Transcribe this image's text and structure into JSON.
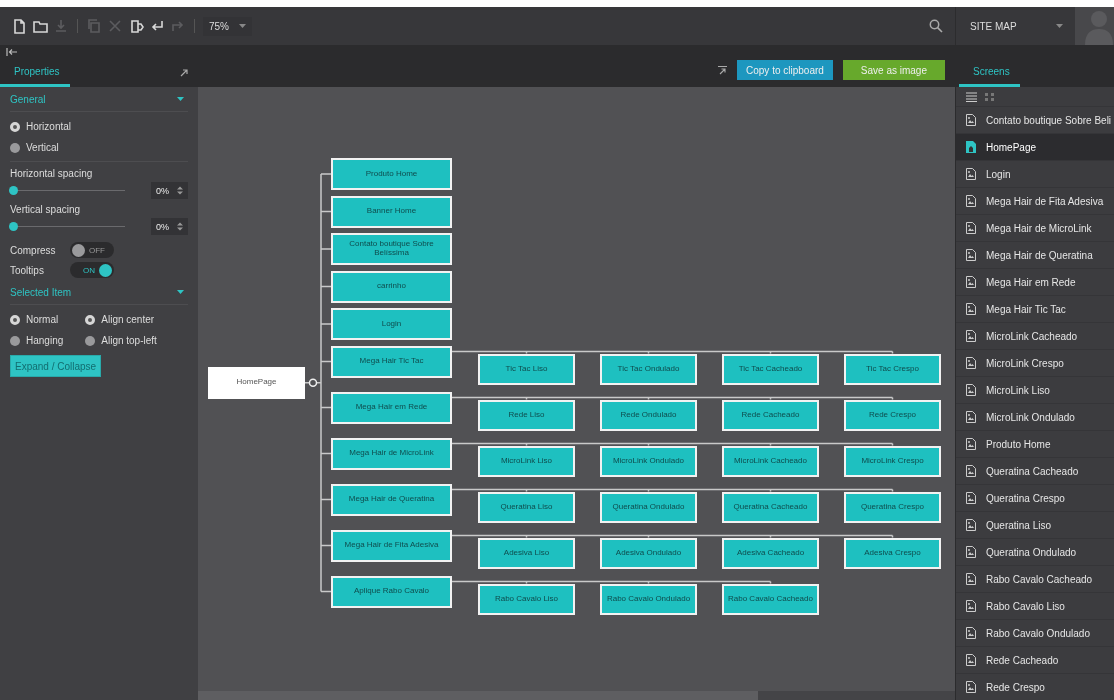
{
  "toolbar": {
    "tool_groups": [
      [
        {
          "kind": "new-file",
          "disabled": false
        },
        {
          "kind": "folder",
          "disabled": false
        },
        {
          "kind": "download",
          "disabled": true
        }
      ],
      [
        {
          "kind": "copy",
          "disabled": true
        },
        {
          "kind": "cut",
          "disabled": true
        },
        {
          "kind": "paste",
          "disabled": false
        },
        {
          "kind": "undo",
          "disabled": false
        },
        {
          "kind": "redo",
          "disabled": true
        }
      ]
    ],
    "zoom": "75%",
    "view_selector": "SITE MAP"
  },
  "properties_panel": {
    "tab": {
      "label": "Properties",
      "selected": true
    },
    "general": {
      "title": "General",
      "orientation": [
        {
          "label": "Horizontal",
          "selected": true
        },
        {
          "label": "Vertical",
          "selected": false
        }
      ],
      "sliders": [
        {
          "label": "Horizontal spacing",
          "level": 0,
          "value": "0%"
        },
        {
          "label": "Vertical spacing",
          "level": 0,
          "value": "0%"
        }
      ],
      "toggles": [
        {
          "label": "Compress",
          "on": false,
          "state_text": "OFF"
        },
        {
          "label": "Tooltips",
          "on": true,
          "state_text": "ON"
        }
      ]
    },
    "selected_item": {
      "title": "Selected Item",
      "radio_columns": [
        [
          {
            "label": "Normal",
            "selected": true
          },
          {
            "label": "Hanging",
            "selected": false
          }
        ],
        [
          {
            "label": "Align center",
            "selected": true
          },
          {
            "label": "Align top-left",
            "selected": false
          }
        ]
      ],
      "button": "Expand / Collapse"
    }
  },
  "actions": [
    {
      "kind": "copy",
      "label": "Copy to clipboard"
    },
    {
      "kind": "save",
      "label": "Save as image"
    }
  ],
  "diagram": {
    "root": {
      "label": "HomePage",
      "children": [
        {
          "label": "Produto Home"
        },
        {
          "label": "Banner Home"
        },
        {
          "label": "Contato boutique Sobre Belíssima"
        },
        {
          "label": "carrinho"
        },
        {
          "label": "Login"
        },
        {
          "label": "Mega Hair Tic Tac",
          "children": [
            {
              "label": "Tic Tac Liso"
            },
            {
              "label": "Tic Tac Ondulado"
            },
            {
              "label": "Tic Tac Cacheado"
            },
            {
              "label": "Tic Tac Crespo"
            }
          ]
        },
        {
          "label": "Mega Hair em Rede",
          "children": [
            {
              "label": "Rede Liso"
            },
            {
              "label": "Rede Ondulado"
            },
            {
              "label": "Rede Cacheado"
            },
            {
              "label": "Rede Crespo"
            }
          ]
        },
        {
          "label": "Mega Hair de MicroLink",
          "children": [
            {
              "label": "MicroLink Liso"
            },
            {
              "label": "MicroLink Ondulado"
            },
            {
              "label": "MicroLink Cacheado"
            },
            {
              "label": "MicroLink Crespo"
            }
          ]
        },
        {
          "label": "Mega Hair de Queratina",
          "children": [
            {
              "label": "Queratina Liso"
            },
            {
              "label": "Queratina Ondulado"
            },
            {
              "label": "Queratina Cacheado"
            },
            {
              "label": "Queratina Crespo"
            }
          ]
        },
        {
          "label": "Mega Hair de Fita Adesiva",
          "children": [
            {
              "label": "Adesiva Liso"
            },
            {
              "label": "Adesiva Ondulado"
            },
            {
              "label": "Adesiva Cacheado"
            },
            {
              "label": "Adesiva Crespo"
            }
          ]
        },
        {
          "label": "Aplique Rabo Cavalo",
          "children": [
            {
              "label": "Rabo Cavalo Liso"
            },
            {
              "label": "Rabo Cavalo Ondulado"
            },
            {
              "label": "Rabo Cavalo Cacheado"
            }
          ]
        }
      ]
    }
  },
  "screens_panel": {
    "tab": {
      "label": "Screens",
      "selected": true
    },
    "view_modes": [
      {
        "kind": "list",
        "selected": true
      },
      {
        "kind": "grid",
        "selected": false
      }
    ],
    "items": [
      {
        "kind": "page",
        "label": "Contato boutique Sobre Beli",
        "selected": false
      },
      {
        "kind": "home",
        "label": "HomePage",
        "selected": true
      },
      {
        "kind": "page",
        "label": "Login",
        "selected": false
      },
      {
        "kind": "page",
        "label": "Mega Hair de Fita Adesiva",
        "selected": false
      },
      {
        "kind": "page",
        "label": "Mega Hair de MicroLink",
        "selected": false
      },
      {
        "kind": "page",
        "label": "Mega Hair de Queratina",
        "selected": false
      },
      {
        "kind": "page",
        "label": "Mega Hair em Rede",
        "selected": false
      },
      {
        "kind": "page",
        "label": "Mega Hair Tic Tac",
        "selected": false
      },
      {
        "kind": "page",
        "label": "MicroLink Cacheado",
        "selected": false
      },
      {
        "kind": "page",
        "label": "MicroLink Crespo",
        "selected": false
      },
      {
        "kind": "page",
        "label": "MicroLink Liso",
        "selected": false
      },
      {
        "kind": "page",
        "label": "MicroLink Ondulado",
        "selected": false
      },
      {
        "kind": "page",
        "label": "Produto Home",
        "selected": false
      },
      {
        "kind": "page",
        "label": "Queratina Cacheado",
        "selected": false
      },
      {
        "kind": "page",
        "label": "Queratina Crespo",
        "selected": false
      },
      {
        "kind": "page",
        "label": "Queratina Liso",
        "selected": false
      },
      {
        "kind": "page",
        "label": "Queratina Ondulado",
        "selected": false
      },
      {
        "kind": "page",
        "label": "Rabo Cavalo Cacheado",
        "selected": false
      },
      {
        "kind": "page",
        "label": "Rabo Cavalo Liso",
        "selected": false
      },
      {
        "kind": "page",
        "label": "Rabo Cavalo Ondulado",
        "selected": false
      },
      {
        "kind": "page",
        "label": "Rede Cacheado",
        "selected": false
      },
      {
        "kind": "page",
        "label": "Rede Crespo",
        "selected": false
      }
    ]
  }
}
